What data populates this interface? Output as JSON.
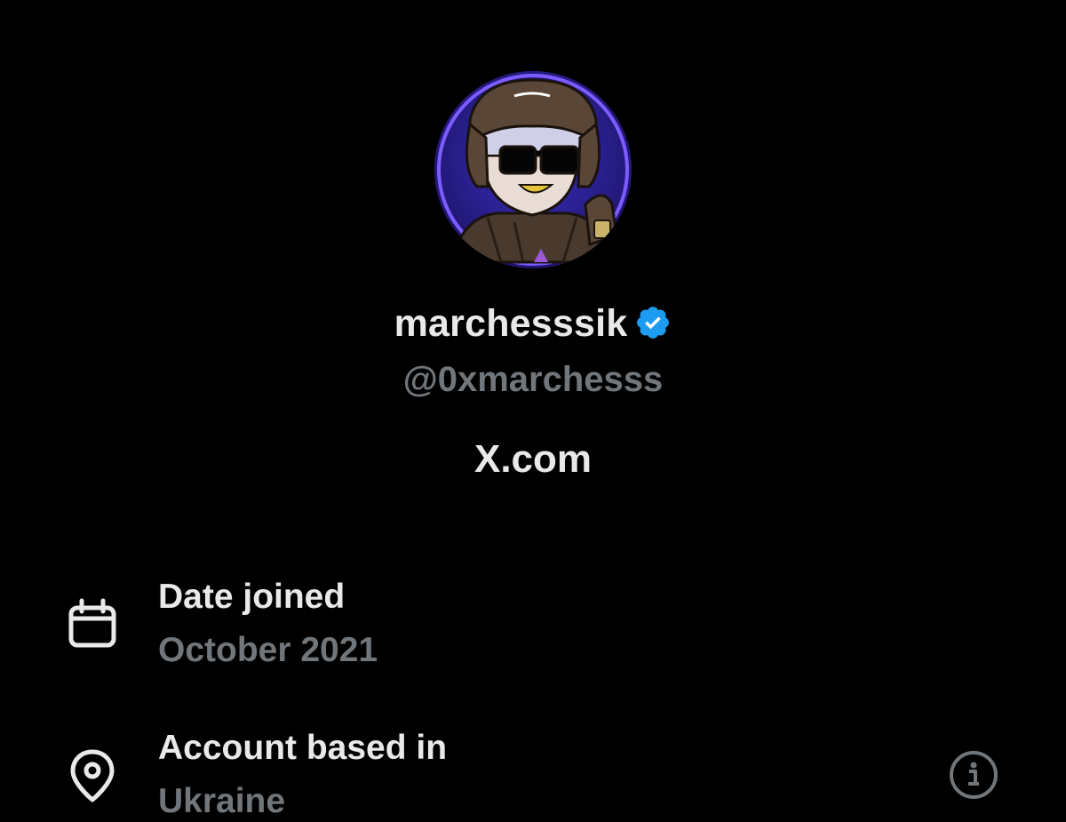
{
  "profile": {
    "display_name": "marchesssik",
    "handle": "@0xmarchesss",
    "site": "X.com",
    "verified": true
  },
  "icons": {
    "verified": "verified-badge-icon",
    "calendar": "calendar-icon",
    "location": "location-pin-icon",
    "info": "info-icon"
  },
  "details": {
    "date_joined": {
      "label": "Date joined",
      "value": "October 2021"
    },
    "account_based_in": {
      "label": "Account based in",
      "value": "Ukraine"
    }
  },
  "colors": {
    "background": "#000000",
    "primary_text": "#e7e9ea",
    "secondary_text": "#71767b",
    "verified_blue": "#1d9bf0"
  }
}
